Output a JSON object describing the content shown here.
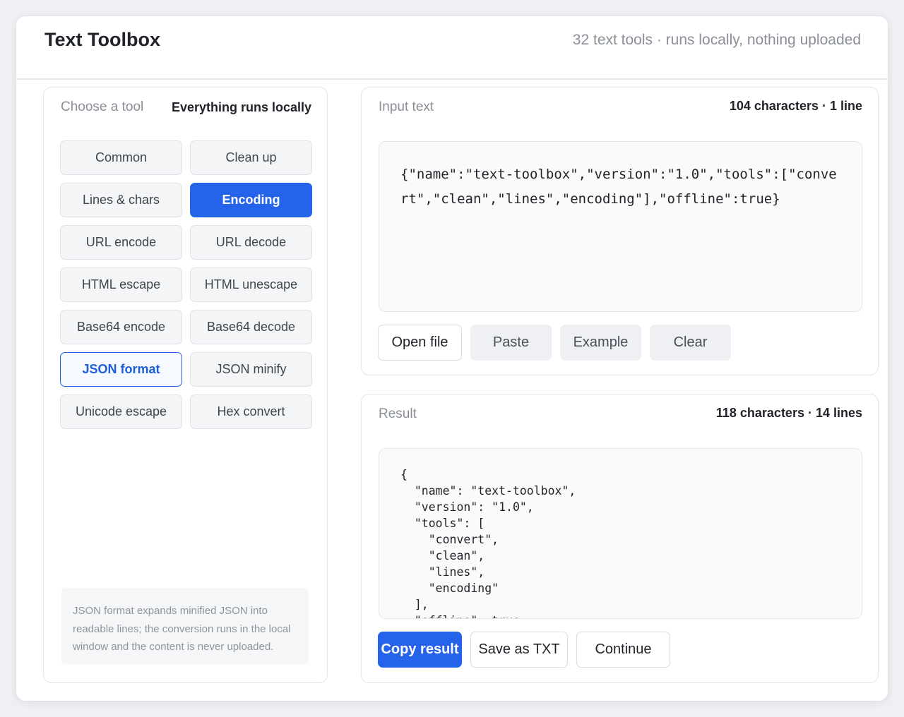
{
  "app": {
    "title": "Text Toolbox",
    "tagline": "32 text tools · runs locally, nothing uploaded"
  },
  "tools_panel": {
    "title": "Choose a tool",
    "meta": "Everything runs locally",
    "buttons": [
      {
        "label": "Common",
        "state": "normal"
      },
      {
        "label": "Clean up",
        "state": "normal"
      },
      {
        "label": "Lines & chars",
        "state": "normal"
      },
      {
        "label": "Encoding",
        "state": "active"
      },
      {
        "label": "URL encode",
        "state": "normal"
      },
      {
        "label": "URL decode",
        "state": "normal"
      },
      {
        "label": "HTML escape",
        "state": "normal"
      },
      {
        "label": "HTML unescape",
        "state": "normal"
      },
      {
        "label": "Base64 encode",
        "state": "normal"
      },
      {
        "label": "Base64 decode",
        "state": "normal"
      },
      {
        "label": "JSON format",
        "state": "selected"
      },
      {
        "label": "JSON minify",
        "state": "normal"
      },
      {
        "label": "Unicode escape",
        "state": "normal"
      },
      {
        "label": "Hex convert",
        "state": "normal"
      }
    ],
    "note": "JSON format expands minified JSON into readable lines; the conversion runs in the local window and the content is never uploaded."
  },
  "input": {
    "title": "Input text",
    "meta": "104 characters · 1 line",
    "text": "{\"name\":\"text-toolbox\",\"version\":\"1.0\",\"tools\":[\"convert\",\"clean\",\"lines\",\"encoding\"],\"offline\":true}",
    "buttons": {
      "open_file": "Open file",
      "paste": "Paste",
      "example": "Example",
      "clear": "Clear"
    }
  },
  "result": {
    "title": "Result",
    "meta": "118 characters · 14 lines",
    "text": "{\n  \"name\": \"text-toolbox\",\n  \"version\": \"1.0\",\n  \"tools\": [\n    \"convert\",\n    \"clean\",\n    \"lines\",\n    \"encoding\"\n  ],\n  \"offline\": true\n}",
    "buttons": {
      "copy": "Copy result",
      "save": "Save as TXT",
      "continue": "Continue"
    }
  },
  "colors": {
    "accent": "#2563eb",
    "background": "#eef0f4"
  }
}
